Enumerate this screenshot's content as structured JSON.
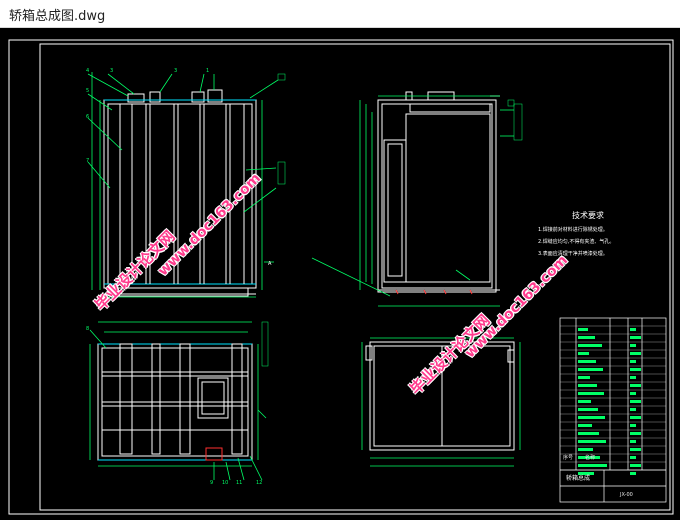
{
  "window": {
    "title": "轿箱总成图.dwg"
  },
  "drawing": {
    "background": "#000000",
    "line_color": "#ffffff",
    "dimension_color": "#00ff66",
    "cyan_color": "#00e5ff",
    "tech_requirements": {
      "title": "技术要求",
      "lines": [
        "1.焊接前对材料进行除锈处理。",
        "2.焊缝应均匀,不得有夹渣、气孔。",
        "3.表面应清理干净并喷漆处理。"
      ]
    },
    "title_block": {
      "part_name": "轿箱总成",
      "drawing_number": "JX-00",
      "header_left": "序号",
      "header_right": "名称"
    },
    "watermarks": [
      {
        "text": "毕业设计论文网",
        "color": "#ff3b8d"
      },
      {
        "text": "www.doc163.com",
        "color": "#ff3b8d"
      },
      {
        "text": "毕业设计论文网",
        "color": "#ff3b8d"
      },
      {
        "text": "www.doc163.com",
        "color": "#ff3b8d"
      }
    ]
  }
}
